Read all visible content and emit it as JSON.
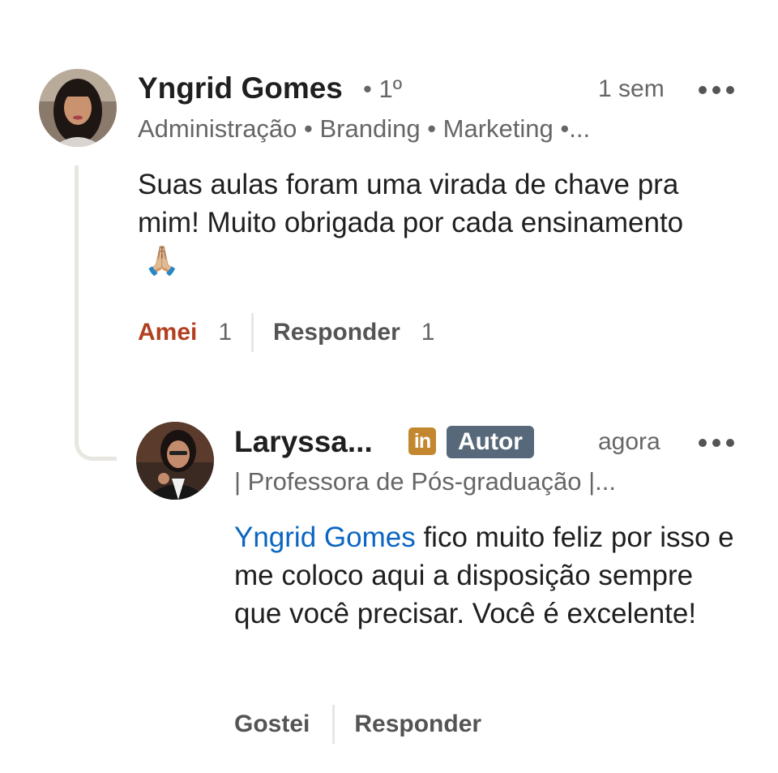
{
  "comment": {
    "author_name": "Yngrid Gomes",
    "degree": "• 1º",
    "time": "1 sem",
    "headline": "Administração • Branding • Marketing •...",
    "text": "Suas aulas foram uma virada de chave pra mim! Muito obrigada por cada ensinamento",
    "emoji": "🙏🏼",
    "reaction_label": "Amei",
    "reaction_count": "1",
    "reply_label": "Responder",
    "reply_count": "1"
  },
  "reply": {
    "author_name": "Laryssa...",
    "linkedin_badge": "in",
    "author_badge": "Autor",
    "time": "agora",
    "headline": "| Professora de Pós-graduação |...",
    "mention": "Yngrid Gomes",
    "text": " fico muito feliz por isso e me coloco aqui a disposição sempre que você precisar. Você é excelente!",
    "like_label": "Gostei",
    "reply_label": "Responder"
  },
  "colors": {
    "reaction_love": "#b24020",
    "mention_link": "#0a66c2",
    "author_badge_bg": "#56687a",
    "linkedin_badge_bg": "#c3882f"
  },
  "icons": [
    "more-options-icon",
    "linkedin-icon",
    "folded-hands-emoji"
  ]
}
